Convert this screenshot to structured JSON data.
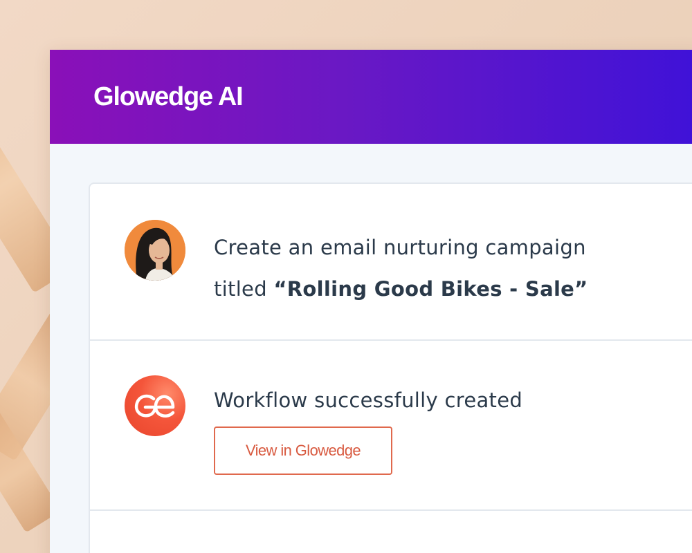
{
  "app": {
    "title": "Glowedge AI"
  },
  "chat": {
    "user_message": {
      "line1": "Create an email nurturing campaign",
      "line2_prefix": "titled ",
      "line2_bold": "“Rolling Good Bikes - Sale”",
      "avatar_icon": "user-avatar-photo"
    },
    "ai_message": {
      "text": "Workflow successfully created",
      "avatar_icon": "glowedge-logo-icon",
      "button_label": "View in Glowedge"
    }
  },
  "colors": {
    "header_gradient_start": "#8a10b8",
    "header_gradient_end": "#3f12d8",
    "accent": "#e0694d",
    "text": "#2b3a4a",
    "panel_bg": "#f3f7fb"
  }
}
